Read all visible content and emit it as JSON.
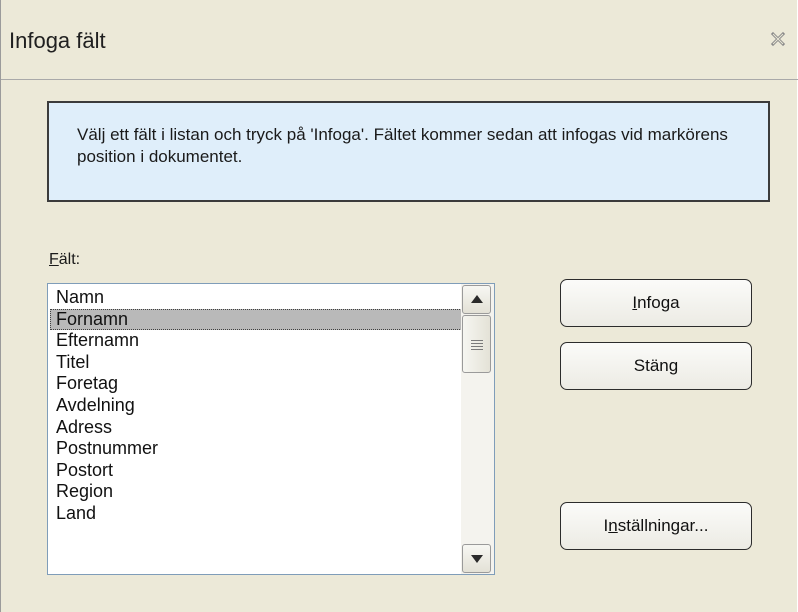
{
  "window": {
    "title": "Infoga fält",
    "close_icon": "close-icon"
  },
  "info": {
    "text": "Välj ett fält i listan och tryck på 'Infoga'. Fältet kommer sedan att infogas vid markörens position i dokumentet."
  },
  "fields_label": {
    "first": "F",
    "rest": "ält:"
  },
  "fields": {
    "items": [
      "Namn",
      "Fornamn",
      "Efternamn",
      "Titel",
      "Foretag",
      "Avdelning",
      "Adress",
      "Postnummer",
      "Postort",
      "Region",
      "Land"
    ],
    "selected": "Fornamn"
  },
  "buttons": {
    "insert": {
      "first": "I",
      "rest": "nfoga"
    },
    "close": {
      "label": "Stäng"
    },
    "settings": {
      "pre": "I",
      "mnemonic": "n",
      "rest": "ställningar..."
    }
  }
}
